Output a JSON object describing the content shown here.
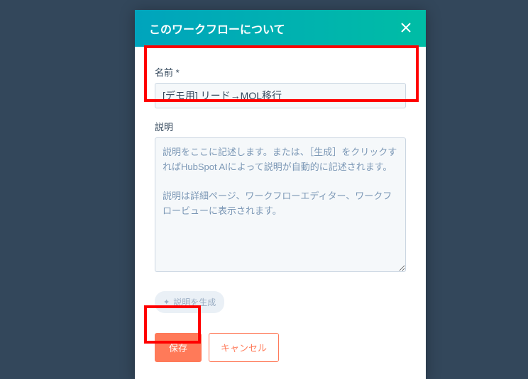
{
  "modal": {
    "title": "このワークフローについて",
    "name_label": "名前 *",
    "name_value": "[デモ用] リード→MQL移行",
    "description_label": "説明",
    "description_placeholder": "説明をここに記述します。または、［生成］をクリックすればHubSpot AIによって説明が自動的に記述されます。\n\n説明は詳細ページ、ワークフローエディター、ワークフロービューに表示されます。",
    "generate_label": "説明を生成",
    "save_label": "保存",
    "cancel_label": "キャンセル"
  }
}
